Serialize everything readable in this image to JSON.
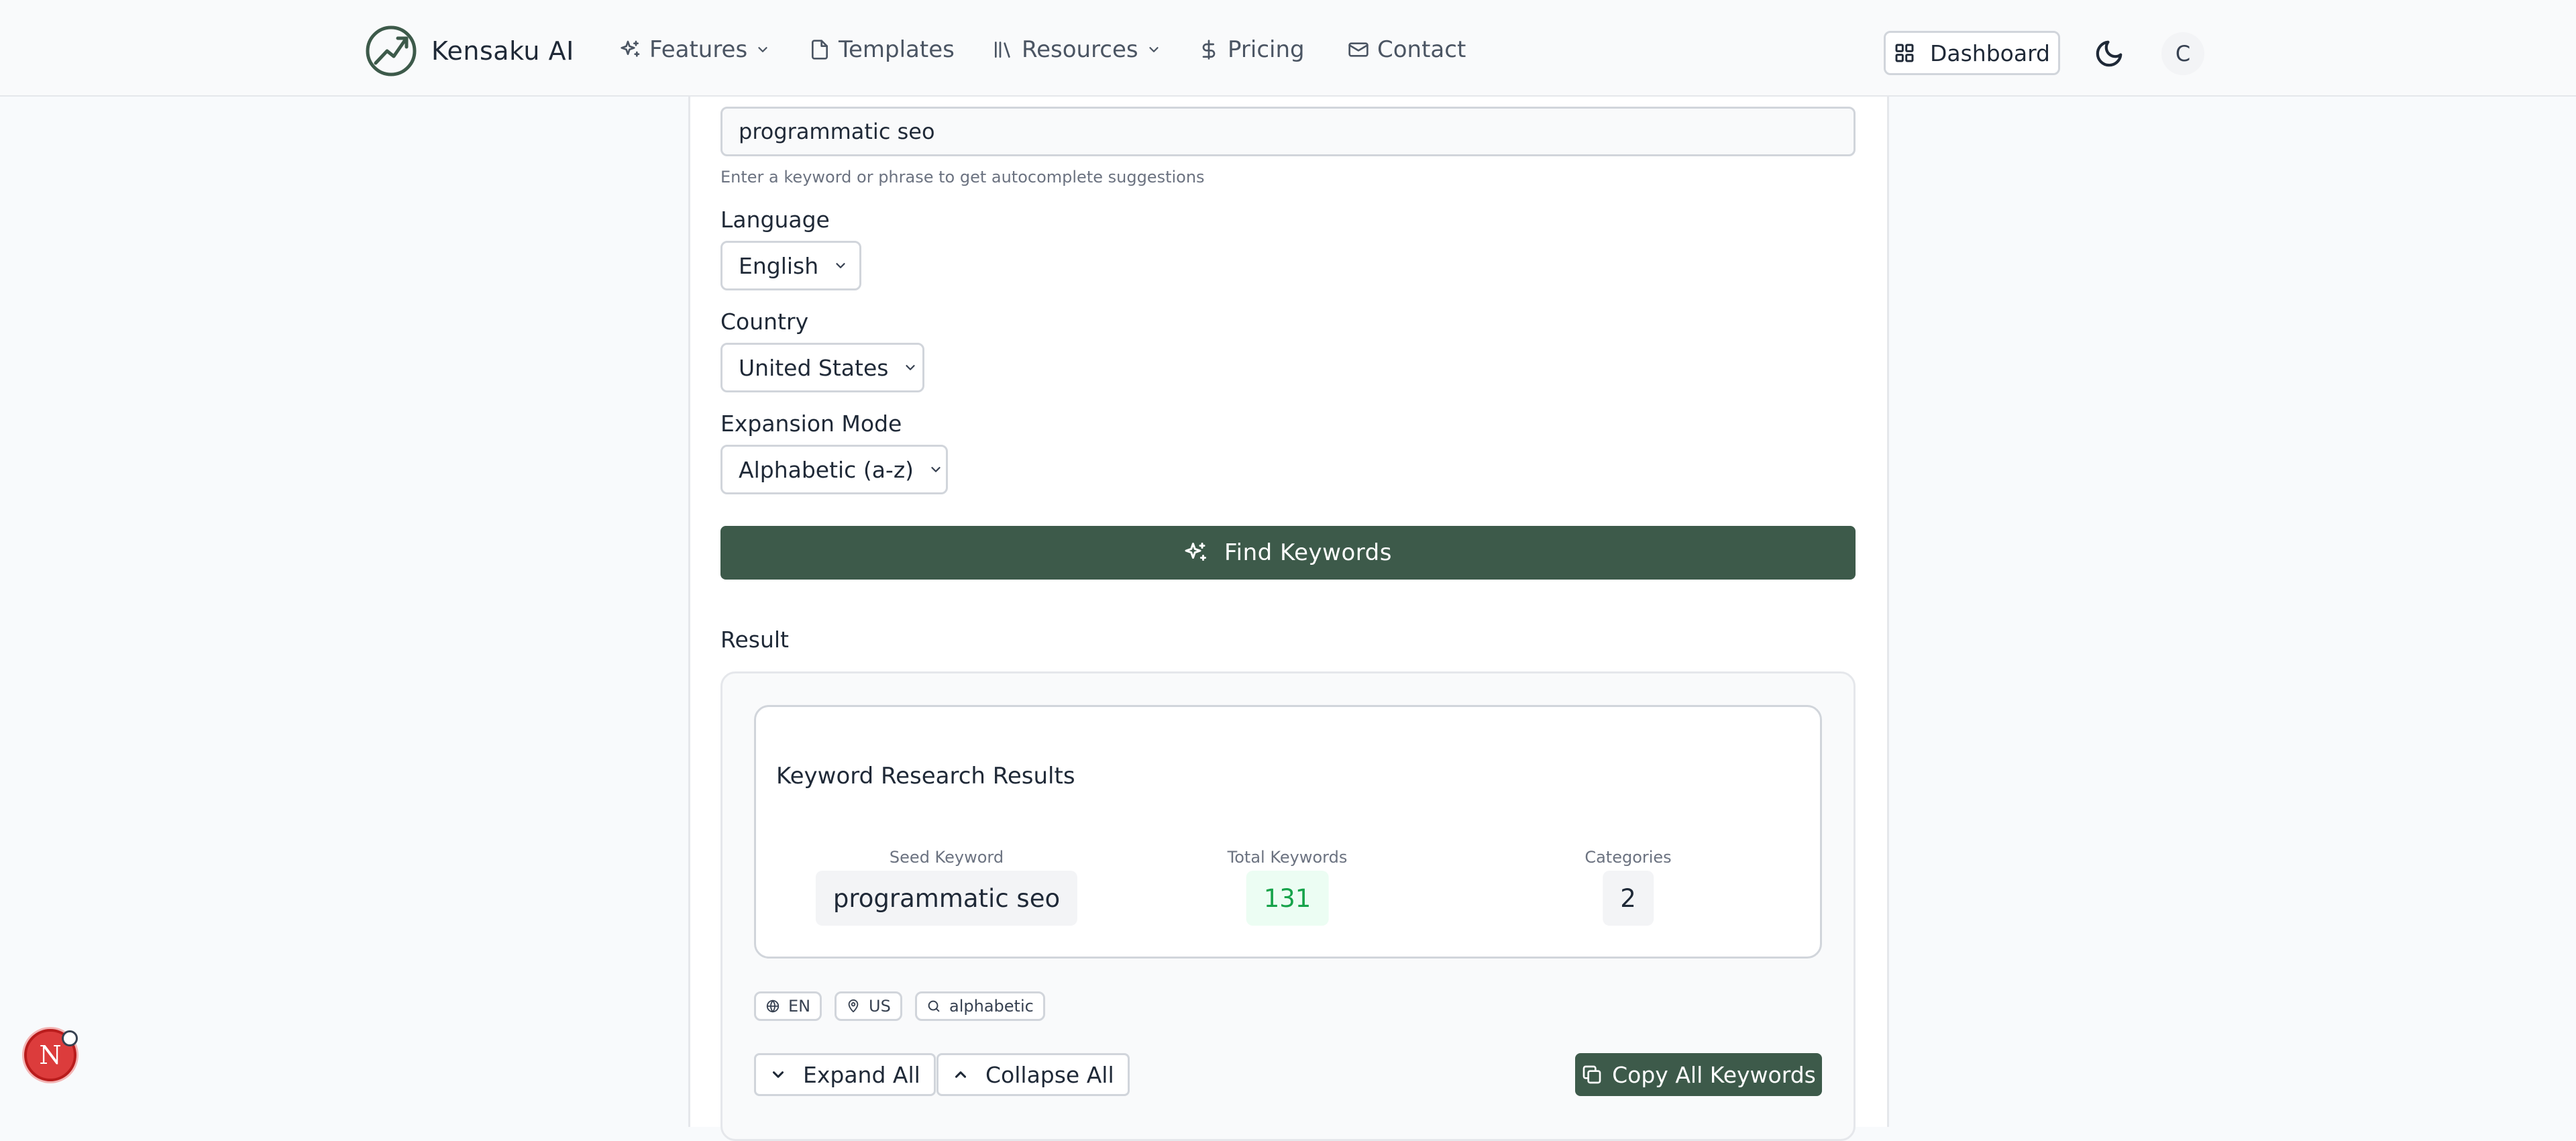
{
  "nav": {
    "brand": "Kensaku AI",
    "items": [
      {
        "label": "Features",
        "icon": "sparkles-icon",
        "dropdown": true
      },
      {
        "label": "Templates",
        "icon": "document-icon",
        "dropdown": false
      },
      {
        "label": "Resources",
        "icon": "library-icon",
        "dropdown": true
      },
      {
        "label": "Pricing",
        "icon": "dollar-icon",
        "dropdown": false
      },
      {
        "label": "Contact",
        "icon": "mail-icon",
        "dropdown": false
      }
    ],
    "dashboard_label": "Dashboard",
    "avatar_initial": "C"
  },
  "form": {
    "keyword_value": "programmatic seo",
    "keyword_hint": "Enter a keyword or phrase to get autocomplete suggestions",
    "language_label": "Language",
    "language_value": "English",
    "country_label": "Country",
    "country_value": "United States",
    "mode_label": "Expansion Mode",
    "mode_value": "Alphabetic (a-z)",
    "submit_label": "Find Keywords"
  },
  "result": {
    "section_label": "Result",
    "card_title": "Keyword Research Results",
    "stats": [
      {
        "label": "Seed Keyword",
        "value": "programmatic seo"
      },
      {
        "label": "Total Keywords",
        "value": "131"
      },
      {
        "label": "Categories",
        "value": "2"
      }
    ],
    "chips": [
      {
        "label": "EN",
        "icon": "globe-icon"
      },
      {
        "label": "US",
        "icon": "map-pin-icon"
      },
      {
        "label": "alphabetic",
        "icon": "search-icon"
      }
    ],
    "expand_label": "Expand All",
    "collapse_label": "Collapse All",
    "copy_label": "Copy All Keywords"
  },
  "floating": {
    "badge_letter": "N"
  },
  "colors": {
    "primary": "#3d5a4a",
    "success_text": "#16a34a",
    "badge_red": "#dc3c3c"
  }
}
